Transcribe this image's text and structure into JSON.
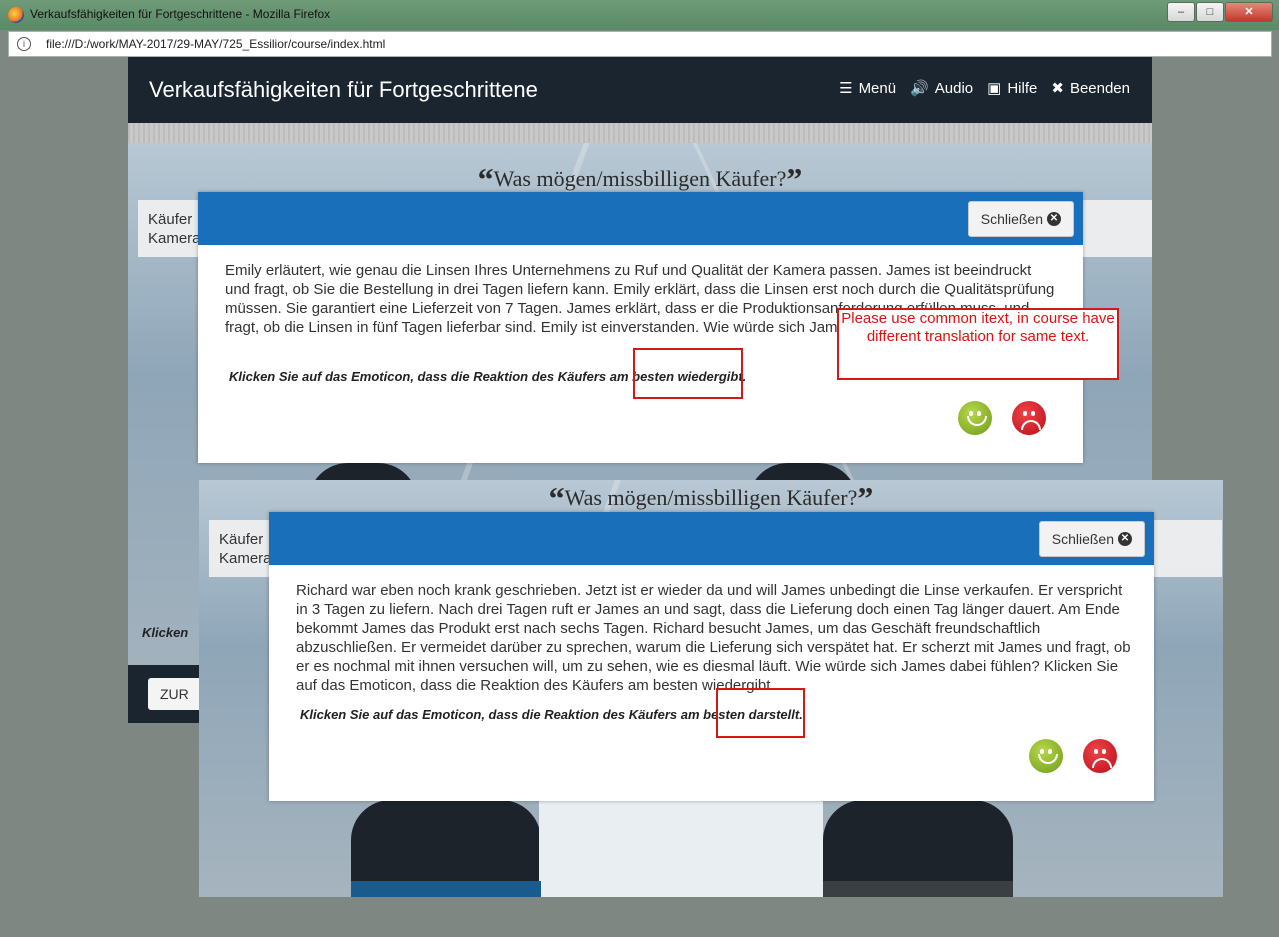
{
  "window": {
    "title": "Verkaufsfähigkeiten für Fortgeschrittene - Mozilla Firefox",
    "url": "file:///D:/work/MAY-2017/29-MAY/725_Essilior/course/index.html"
  },
  "course": {
    "title": "Verkaufsfähigkeiten für Fortgeschrittene",
    "nav": {
      "menu": "Menü",
      "audio": "Audio",
      "help": "Hilfe",
      "exit": "Beenden"
    }
  },
  "slide": {
    "title": "Was mögen/missbilligen Käufer?",
    "open_quote": "“",
    "close_quote": "”",
    "box_text_line1": "Käufer",
    "box_text_line2": "Kamera",
    "klick_text": "Klicken",
    "back_button": "ZUR"
  },
  "modal1": {
    "close_label": "Schließen",
    "body": "Emily erläutert, wie genau die Linsen Ihres Unternehmens zu Ruf und Qualität der Kamera passen. James ist beeindruckt und fragt, ob Sie die Bestellung in drei Tagen liefern kann. Emily erklärt, dass die Linsen erst noch durch die Qualitätsprüfung müssen. Sie garantiert eine Lieferzeit von 7 Tagen. James erklärt, dass er die Produktionsanforderung erfüllen muss, und fragt, ob die Linsen in fünf Tagen lieferbar sind. Emily ist einverstanden. Wie würde sich James dabei fühlen?",
    "instruction": "Klicken Sie auf das Emoticon, dass die Reaktion des Käufers am besten wiedergibt."
  },
  "modal2": {
    "close_label": "Schließen",
    "body": "Richard war eben noch krank geschrieben. Jetzt ist er wieder da und will James unbedingt die Linse verkaufen. Er verspricht in 3 Tagen zu liefern. Nach drei Tagen ruft er James an und sagt, dass die Lieferung doch einen Tag länger dauert. Am Ende bekommt James das Produkt erst nach sechs Tagen. Richard besucht James, um das Geschäft freundschaftlich abzuschließen. Er vermeidet darüber zu sprechen, warum die Lieferung sich verspätet hat. Er scherzt mit James und fragt, ob er es nochmal mit ihnen versuchen will, um zu sehen, wie es diesmal läuft. Wie würde sich James dabei fühlen? Klicken Sie auf das Emoticon, dass die Reaktion des Käufers am besten wiedergibt.",
    "instruction": "Klicken Sie auf das Emoticon, dass die Reaktion des Käufers am besten darstellt."
  },
  "review_comment": "Please use common itext, in course have different translation for same text.",
  "colors": {
    "header": "#1b2530",
    "modal_header": "#1a6fba",
    "annotation": "#d01a1a",
    "happy": "#8bb52a",
    "sad": "#d71920"
  },
  "icons": [
    "menu-icon",
    "audio-icon",
    "help-icon",
    "close-icon",
    "happy-emoticon-icon",
    "sad-emoticon-icon"
  ]
}
